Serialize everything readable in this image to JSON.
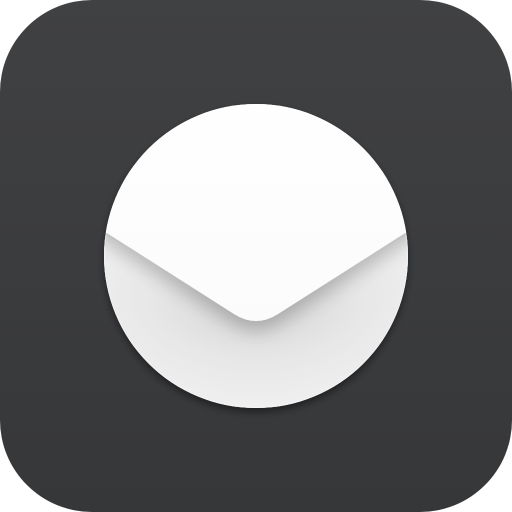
{
  "app_icon": {
    "icon": "mail-envelope-icon",
    "colors": {
      "background": "#3b3c3e",
      "disc": "#f2f2f2",
      "envelope_flap": "#ffffff",
      "envelope_body": "#e9e9e9"
    }
  }
}
